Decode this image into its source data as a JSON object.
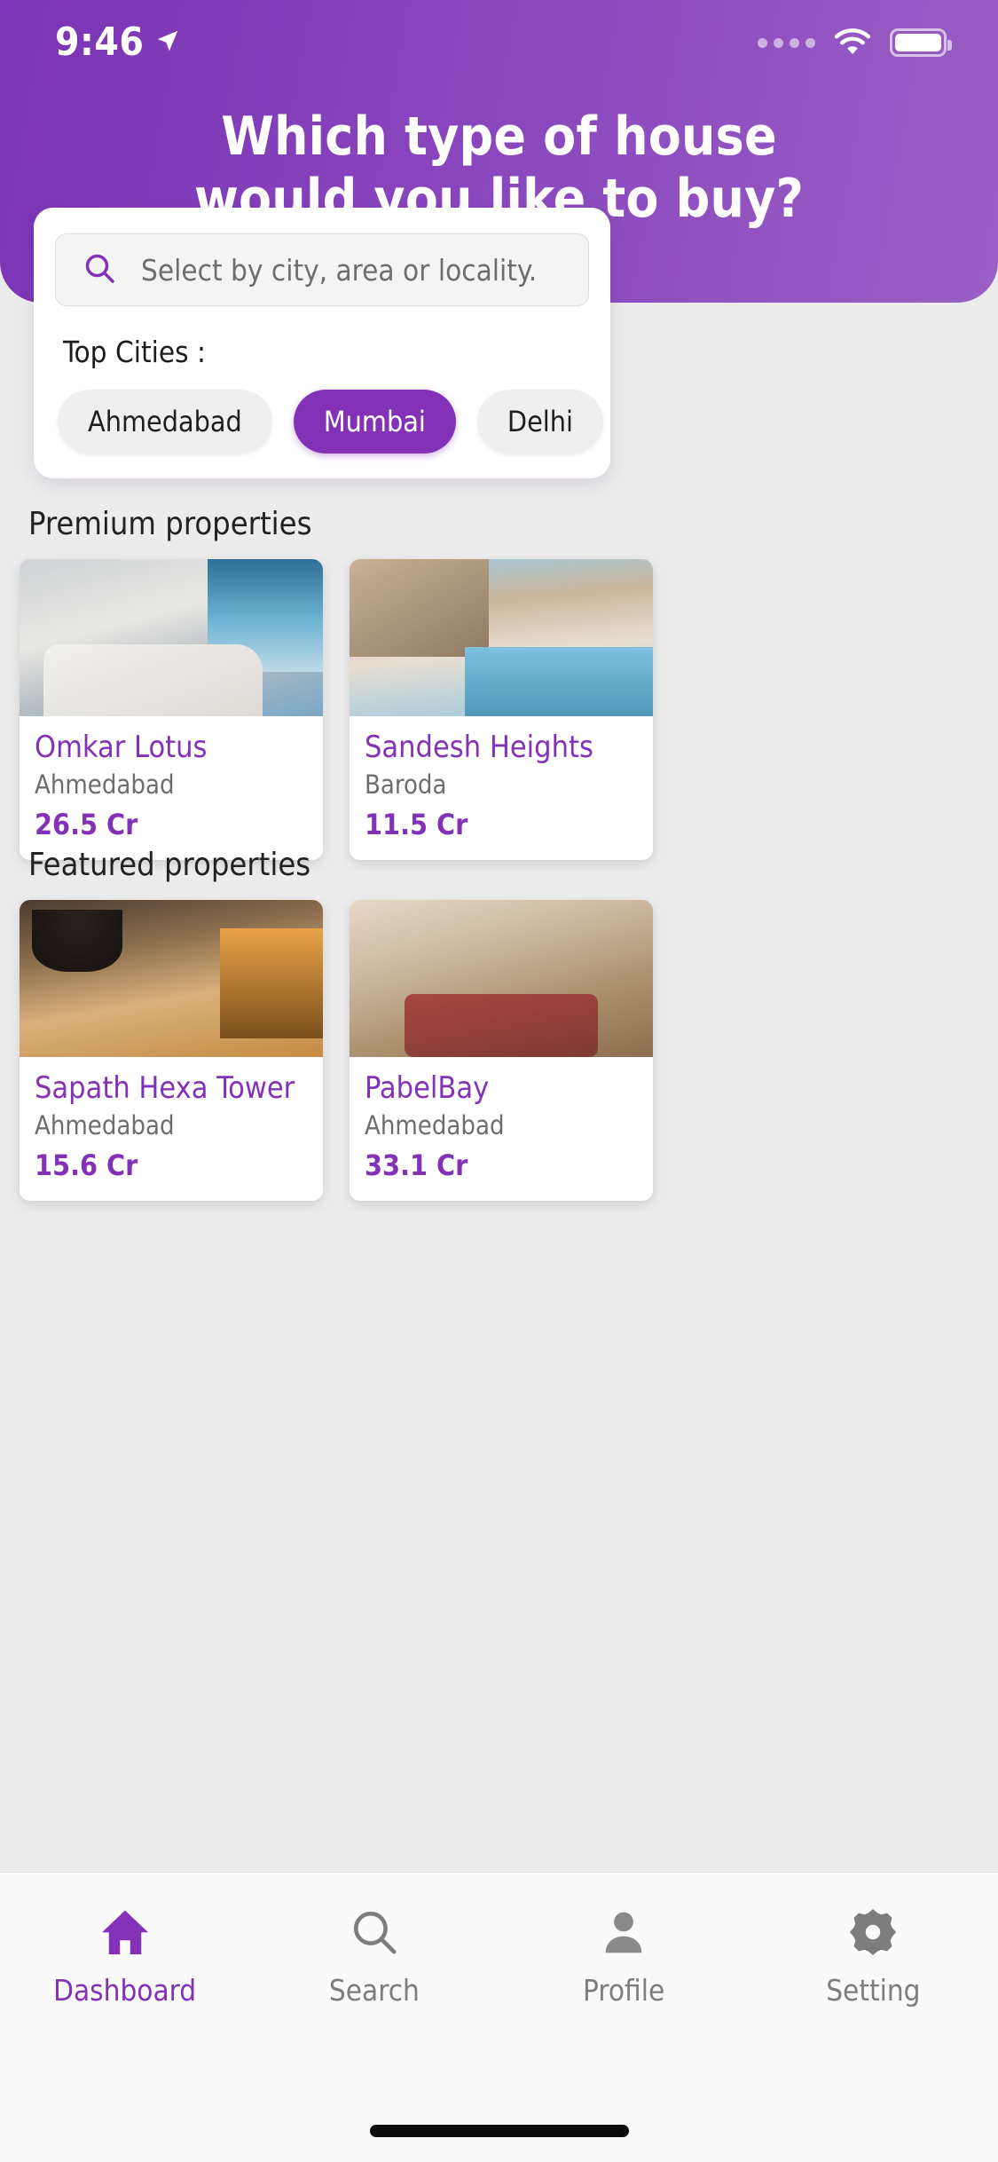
{
  "status_bar": {
    "time": "9:46",
    "location_icon": "location-arrow-icon",
    "signal_icon": "signal-dots-icon",
    "wifi_icon": "wifi-icon",
    "battery_icon": "battery-full-icon"
  },
  "header": {
    "title_line1": "Which type of house",
    "title_line2": "would you like to buy?",
    "gradient_from": "#7a34b5",
    "gradient_to": "#9a5fc5"
  },
  "search": {
    "icon": "search-icon",
    "placeholder": "Select by city, area or locality.",
    "value": ""
  },
  "top_cities": {
    "label": "Top Cities :",
    "selected": "Mumbai",
    "chips": [
      {
        "label": "Ahmedabad",
        "active": false
      },
      {
        "label": "Mumbai",
        "active": true
      },
      {
        "label": "Delhi",
        "active": false
      },
      {
        "label": "",
        "active": false
      }
    ]
  },
  "sections": [
    {
      "title": "Premium properties",
      "cards": [
        {
          "name": "Omkar Lotus",
          "city": "Ahmedabad",
          "price": "26.5 Cr",
          "photo": "ph-a"
        },
        {
          "name": "Sandesh Heights",
          "city": "Baroda",
          "price": "11.5 Cr",
          "photo": "ph-b"
        }
      ]
    },
    {
      "title": "Featured properties",
      "cards": [
        {
          "name": "Sapath Hexa Tower",
          "city": "Ahmedabad",
          "price": "15.6 Cr",
          "photo": "ph-c"
        },
        {
          "name": "PabelBay",
          "city": "Ahmedabad",
          "price": "33.1 Cr",
          "photo": "ph-d"
        }
      ]
    }
  ],
  "bottom_nav": {
    "active": "Dashboard",
    "accent": "#8332b8",
    "inactive": "#7d7d7d",
    "items": [
      {
        "label": "Dashboard",
        "icon": "home-icon",
        "active": true
      },
      {
        "label": "Search",
        "icon": "search-icon",
        "active": false
      },
      {
        "label": "Profile",
        "icon": "person-icon",
        "active": false
      },
      {
        "label": "Setting",
        "icon": "gear-icon",
        "active": false
      }
    ]
  }
}
